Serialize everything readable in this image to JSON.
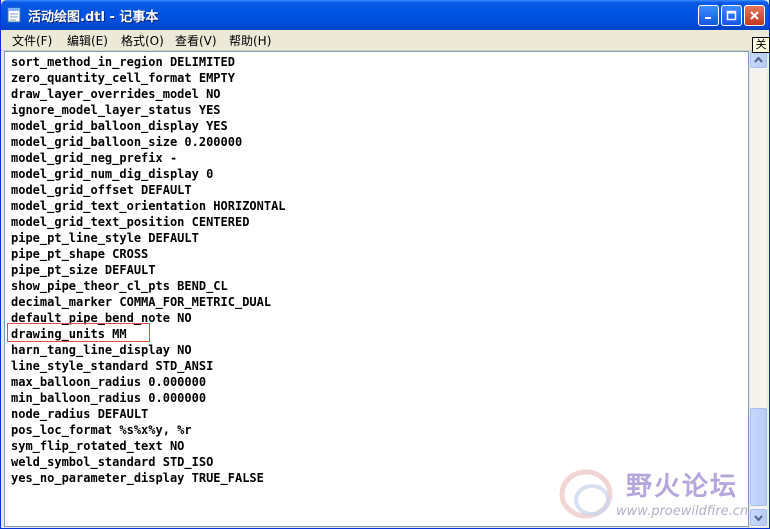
{
  "window": {
    "title": "活动绘图.dtl - 记事本"
  },
  "menu": [
    {
      "label": "文件(F)"
    },
    {
      "label": "编辑(E)"
    },
    {
      "label": "格式(O)"
    },
    {
      "label": "查看(V)"
    },
    {
      "label": "帮助(H)"
    }
  ],
  "tooltip": "关",
  "editor": {
    "lines": [
      "sort_method_in_region DELIMITED",
      "zero_quantity_cell_format EMPTY",
      "draw_layer_overrides_model NO",
      "ignore_model_layer_status YES",
      "model_grid_balloon_display YES",
      "model_grid_balloon_size 0.200000",
      "model_grid_neg_prefix -",
      "model_grid_num_dig_display 0",
      "model_grid_offset DEFAULT",
      "model_grid_text_orientation HORIZONTAL",
      "model_grid_text_position CENTERED",
      "pipe_pt_line_style DEFAULT",
      "pipe_pt_shape CROSS",
      "pipe_pt_size DEFAULT",
      "show_pipe_theor_cl_pts BEND_CL",
      "decimal_marker COMMA_FOR_METRIC_DUAL",
      "default_pipe_bend_note NO",
      "drawing_units MM",
      "harn_tang_line_display NO",
      "line_style_standard STD_ANSI",
      "max_balloon_radius 0.000000",
      "min_balloon_radius 0.000000",
      "node_radius DEFAULT",
      "pos_loc_format %s%x%y, %r",
      "sym_flip_rotated_text NO",
      "weld_symbol_standard STD_ISO",
      "yes_no_parameter_display TRUE_FALSE"
    ]
  },
  "watermark": {
    "name": "野火论坛",
    "url": "www.proewildfire.cn"
  },
  "colors": {
    "titlebar": "#0054e3",
    "highlight": "#e05050",
    "window_bg": "#ece9d8"
  }
}
